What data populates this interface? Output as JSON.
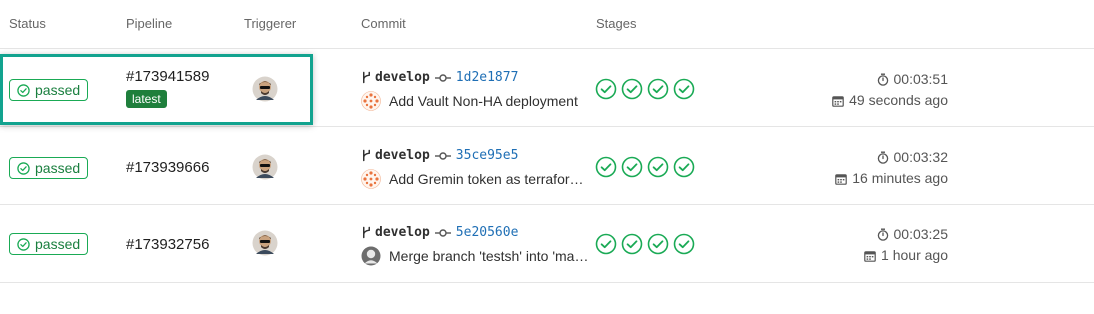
{
  "header": {
    "status": "Status",
    "pipeline": "Pipeline",
    "triggerer": "Triggerer",
    "commit": "Commit",
    "stages": "Stages"
  },
  "colors": {
    "success": "#1aaa55",
    "highlight": "#12a38f",
    "link": "#1f6fb5",
    "latest_badge": "#1f7f3c"
  },
  "rows": [
    {
      "status": "passed",
      "pipeline_id": "#173941589",
      "badge": "latest",
      "branch": "develop",
      "sha": "1d2e1877",
      "commit_title": "Add Vault Non-HA deployment",
      "author_avatar": "orange-identicon",
      "duration": "00:03:51",
      "finished": "49 seconds ago",
      "stages": [
        "passed",
        "passed",
        "passed",
        "passed"
      ]
    },
    {
      "status": "passed",
      "pipeline_id": "#173939666",
      "branch": "develop",
      "sha": "35ce95e5",
      "commit_title": "Add Gremin token as terraform variable",
      "author_avatar": "orange-identicon",
      "duration": "00:03:32",
      "finished": "16 minutes ago",
      "stages": [
        "passed",
        "passed",
        "passed",
        "passed"
      ]
    },
    {
      "status": "passed",
      "pipeline_id": "#173932756",
      "branch": "develop",
      "sha": "5e20560e",
      "commit_title": "Merge branch 'testsh' into 'master'",
      "author_avatar": "photo",
      "duration": "00:03:25",
      "finished": "1 hour ago",
      "stages": [
        "passed",
        "passed",
        "passed",
        "passed"
      ]
    }
  ]
}
